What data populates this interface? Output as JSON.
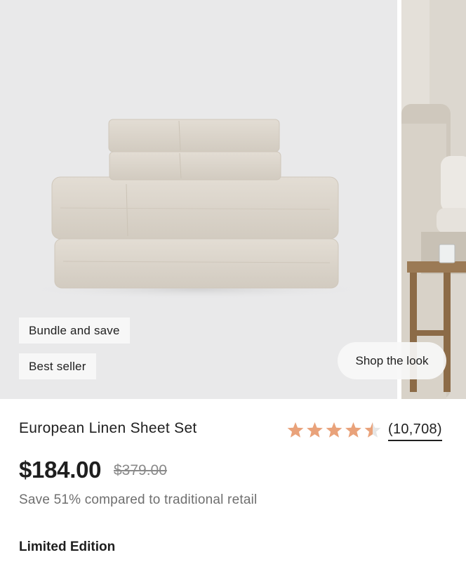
{
  "badges": {
    "bundle": "Bundle and save",
    "best_seller": "Best seller"
  },
  "shop_the_look_label": "Shop the look",
  "product": {
    "title": "European Linen Sheet Set",
    "rating": 4.5,
    "rating_max": 5,
    "review_count": "(10,708)",
    "price": "$184.00",
    "original_price": "$379.00",
    "savings_text": "Save 51% compared to traditional retail",
    "edition": "Limited Edition"
  },
  "colors": {
    "star": "#e9a27a",
    "star_empty": "#e6e6e6",
    "image_bg": "#e9e9ea",
    "linen": "#ddd6cc"
  }
}
